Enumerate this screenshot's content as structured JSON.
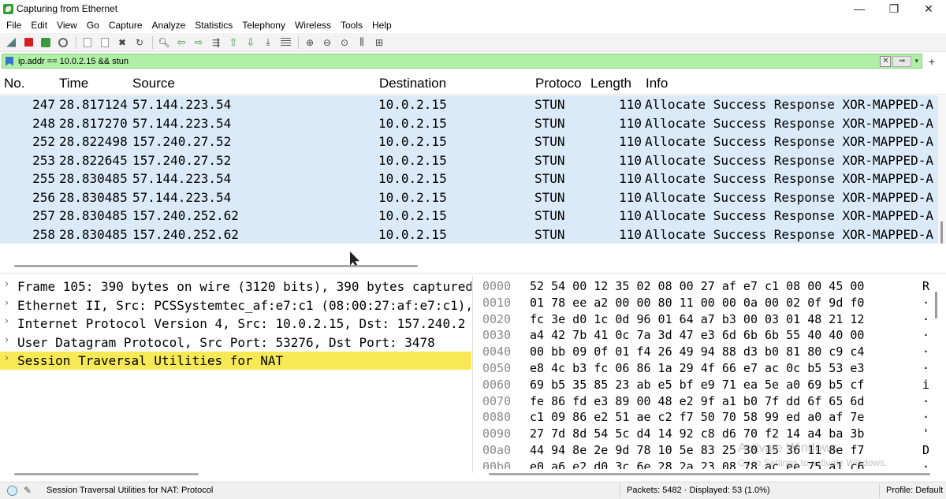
{
  "window": {
    "title": "Capturing from Ethernet",
    "minimize": "—",
    "maximize": "❐",
    "close": "✕"
  },
  "menu": [
    "File",
    "Edit",
    "View",
    "Go",
    "Capture",
    "Analyze",
    "Statistics",
    "Telephony",
    "Wireless",
    "Tools",
    "Help"
  ],
  "filter": {
    "value": "ip.addr == 10.0.2.15 && stun",
    "plus": "+",
    "accent_color": "#aff0a6"
  },
  "packet_list": {
    "headers": {
      "no": "No.",
      "time": "Time",
      "source": "Source",
      "destination": "Destination",
      "protocol": "Protoco",
      "length": "Length",
      "info": "Info"
    },
    "rows": [
      {
        "no": "247",
        "time": "28.817124",
        "src": "57.144.223.54",
        "dst": "10.0.2.15",
        "proto": "STUN",
        "len": "110",
        "info": "Allocate Success Response XOR-MAPPED-A"
      },
      {
        "no": "248",
        "time": "28.817270",
        "src": "57.144.223.54",
        "dst": "10.0.2.15",
        "proto": "STUN",
        "len": "110",
        "info": "Allocate Success Response XOR-MAPPED-A"
      },
      {
        "no": "252",
        "time": "28.822498",
        "src": "157.240.27.52",
        "dst": "10.0.2.15",
        "proto": "STUN",
        "len": "110",
        "info": "Allocate Success Response XOR-MAPPED-A"
      },
      {
        "no": "253",
        "time": "28.822645",
        "src": "157.240.27.52",
        "dst": "10.0.2.15",
        "proto": "STUN",
        "len": "110",
        "info": "Allocate Success Response XOR-MAPPED-A"
      },
      {
        "no": "255",
        "time": "28.830485",
        "src": "57.144.223.54",
        "dst": "10.0.2.15",
        "proto": "STUN",
        "len": "110",
        "info": "Allocate Success Response XOR-MAPPED-A"
      },
      {
        "no": "256",
        "time": "28.830485",
        "src": "57.144.223.54",
        "dst": "10.0.2.15",
        "proto": "STUN",
        "len": "110",
        "info": "Allocate Success Response XOR-MAPPED-A"
      },
      {
        "no": "257",
        "time": "28.830485",
        "src": "157.240.252.62",
        "dst": "10.0.2.15",
        "proto": "STUN",
        "len": "110",
        "info": "Allocate Success Response XOR-MAPPED-A"
      },
      {
        "no": "258",
        "time": "28.830485",
        "src": "157.240.252.62",
        "dst": "10.0.2.15",
        "proto": "STUN",
        "len": "110",
        "info": "Allocate Success Response XOR-MAPPED-A"
      }
    ],
    "row_color": "#dbeaf8"
  },
  "details": {
    "rows": [
      "Frame 105: 390 bytes on wire (3120 bits), 390 bytes captured",
      "Ethernet II, Src: PCSSystemtec_af:e7:c1 (08:00:27:af:e7:c1), Dst:",
      "Internet Protocol Version 4, Src: 10.0.2.15, Dst: 157.240.2",
      "User Datagram Protocol, Src Port: 53276, Dst Port: 3478",
      "Session Traversal Utilities for NAT"
    ],
    "selected_index": 4,
    "selected_color": "#f7e955"
  },
  "bytes": {
    "rows": [
      {
        "off": "0000",
        "hex": "52 54 00 12 35 02 08 00  27 af e7 c1 08 00 45 00",
        "ascii": "R"
      },
      {
        "off": "0010",
        "hex": "01 78 ee a2 00 00 80 11  00 00 0a 00 02 0f 9d f0",
        "ascii": "·"
      },
      {
        "off": "0020",
        "hex": "fc 3e d0 1c 0d 96 01 64  a7 b3 00 03 01 48 21 12",
        "ascii": "·"
      },
      {
        "off": "0030",
        "hex": "a4 42 7b 41 0c 7a 3d 47  e3 6d 6b 6b 55 40 40 00",
        "ascii": "·"
      },
      {
        "off": "0040",
        "hex": "00 bb 09 0f 01 f4 26 49  94 88 d3 b0 81 80 c9 c4",
        "ascii": "·"
      },
      {
        "off": "0050",
        "hex": "e8 4c b3 fc 06 86 1a 29  4f 66 e7 ac 0c b5 53 e3",
        "ascii": "·"
      },
      {
        "off": "0060",
        "hex": "69 b5 35 85 23 ab e5 bf  e9 71 ea 5e a0 69 b5 cf",
        "ascii": "i"
      },
      {
        "off": "0070",
        "hex": "fe 86 fd e3 89 00 48 e2  9f a1 b0 7f dd 6f 65 6d",
        "ascii": "·"
      },
      {
        "off": "0080",
        "hex": "c1 09 86 e2 51 ae c2 f7  50 70 58 99 ed a0 af 7e",
        "ascii": "·"
      },
      {
        "off": "0090",
        "hex": "27 7d 8d 54 5c d4 14 92  c8 d6 70 f2 14 a4 ba 3b",
        "ascii": "'"
      },
      {
        "off": "00a0",
        "hex": "44 94 8e 2e 9d 78 10 5e  83 25 30 15 36 11 8e f7",
        "ascii": "D"
      },
      {
        "off": "00b0",
        "hex": "e0 a6 e2 d0 3c 6e 28 2a  23 08 78 ac ee 75 a1 c6",
        "ascii": "·"
      }
    ],
    "watermark": "Activate Windows",
    "watermark_sub": "Go to Settings to activate Windows."
  },
  "status": {
    "text": "Session Traversal Utilities for NAT: Protocol",
    "packets": "Packets: 5482 · Displayed: 53 (1.0%)",
    "profile": "Profile: Default"
  }
}
